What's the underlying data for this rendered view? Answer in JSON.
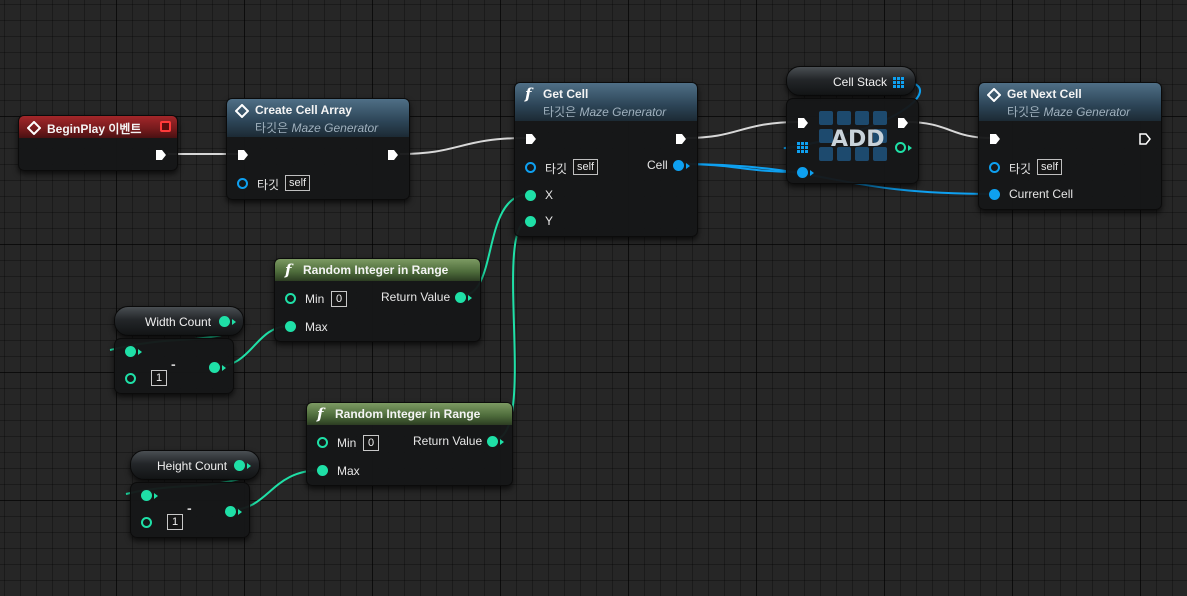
{
  "colors": {
    "exec_wire": "#e8e8e8",
    "int_pin": "#1fe0a7",
    "object_pin": "#0ea0f0",
    "function_header": "#4f6f86",
    "pure_function_header": "#6d8c56",
    "event_header": "#8e2225"
  },
  "nodes": {
    "begin_play": {
      "title": "BeginPlay 이벤트",
      "icon": "event-diamond-icon"
    },
    "create_cell_array": {
      "title": "Create Cell Array",
      "subtitle_prefix": "타깃은",
      "subtitle_target": "Maze Generator",
      "target_label": "타깃",
      "target_value": "self"
    },
    "get_cell": {
      "title": "Get Cell",
      "subtitle_prefix": "타깃은",
      "subtitle_target": "Maze Generator",
      "target_label": "타깃",
      "target_value": "self",
      "x_label": "X",
      "y_label": "Y",
      "cell_label": "Cell"
    },
    "cell_stack": {
      "label": "Cell Stack"
    },
    "add": {
      "label": "ADD"
    },
    "get_next_cell": {
      "title": "Get Next Cell",
      "subtitle_prefix": "타깃은",
      "subtitle_target": "Maze Generator",
      "target_label": "타깃",
      "target_value": "self",
      "current_cell_label": "Current Cell"
    },
    "random_integer_1": {
      "title": "Random Integer in Range",
      "min_label": "Min",
      "min_value": "0",
      "max_label": "Max",
      "return_label": "Return Value"
    },
    "random_integer_2": {
      "title": "Random Integer in Range",
      "min_label": "Min",
      "min_value": "0",
      "max_label": "Max",
      "return_label": "Return Value"
    },
    "width_count": {
      "label": "Width Count"
    },
    "height_count": {
      "label": "Height Count"
    },
    "subtract_1": {
      "symbol": "-",
      "value": "1"
    },
    "subtract_2": {
      "symbol": "-",
      "value": "1"
    }
  }
}
